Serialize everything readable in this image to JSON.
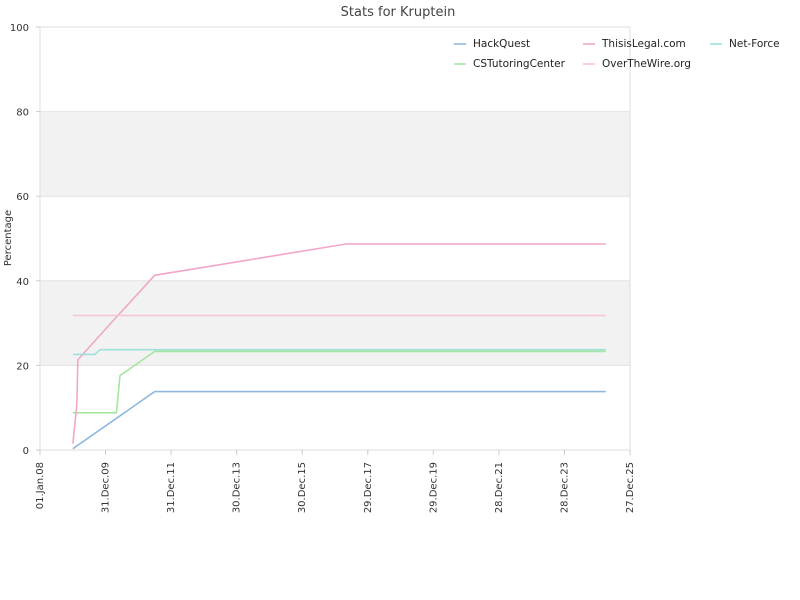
{
  "chart_data": {
    "type": "line",
    "title": "Stats for Kruptein",
    "xlabel": "",
    "ylabel": "Percentage",
    "ylim": [
      0,
      100
    ],
    "xlim": [
      "2008-01-01",
      "2025-12-27"
    ],
    "yticks": [
      0,
      20,
      40,
      60,
      80,
      100
    ],
    "xticks": [
      {
        "date": "2008-01-01",
        "label": "01.Jan.08"
      },
      {
        "date": "2009-12-31",
        "label": "31.Dec.09"
      },
      {
        "date": "2011-12-31",
        "label": "31.Dec.11"
      },
      {
        "date": "2013-12-30",
        "label": "30.Dec.13"
      },
      {
        "date": "2015-12-30",
        "label": "30.Dec.15"
      },
      {
        "date": "2017-12-29",
        "label": "29.Dec.17"
      },
      {
        "date": "2019-12-29",
        "label": "29.Dec.19"
      },
      {
        "date": "2021-12-28",
        "label": "28.Dec.21"
      },
      {
        "date": "2023-12-28",
        "label": "28.Dec.23"
      },
      {
        "date": "2025-12-27",
        "label": "27.Dec.25"
      }
    ],
    "grid": "horizontal alternating bands",
    "legend_position": "top-right",
    "series": [
      {
        "name": "HackQuest",
        "color": "#8fb8e0",
        "x": [
          "2009-01-01",
          "2011-07-01",
          "2025-04-01"
        ],
        "y": [
          0.3,
          13.8,
          13.8
        ]
      },
      {
        "name": "CSTutoringCenter",
        "color": "#a6e6a0",
        "x": [
          "2009-01-01",
          "2010-05-01",
          "2010-06-10",
          "2011-07-01",
          "2025-04-01"
        ],
        "y": [
          8.8,
          8.8,
          17.6,
          23.3,
          23.3
        ]
      },
      {
        "name": "ThisisLegal.com",
        "color": "#f2a6c8",
        "x": [
          "2009-01-01",
          "2009-02-15",
          "2009-02-25",
          "2010-03-01",
          "2011-07-01",
          "2017-05-01",
          "2025-04-01"
        ],
        "y": [
          1.5,
          11.0,
          21.3,
          30.0,
          41.3,
          48.7,
          48.7
        ]
      },
      {
        "name": "OverTheWire.org",
        "color": "#f7c4d6",
        "x": [
          "2009-01-01",
          "2025-04-01"
        ],
        "y": [
          31.8,
          31.8
        ]
      },
      {
        "name": "Net-Force",
        "color": "#a0e0dc",
        "x": [
          "2009-01-01",
          "2009-09-01",
          "2009-11-01",
          "2025-04-01"
        ],
        "y": [
          22.6,
          22.6,
          23.7,
          23.7
        ]
      }
    ]
  }
}
